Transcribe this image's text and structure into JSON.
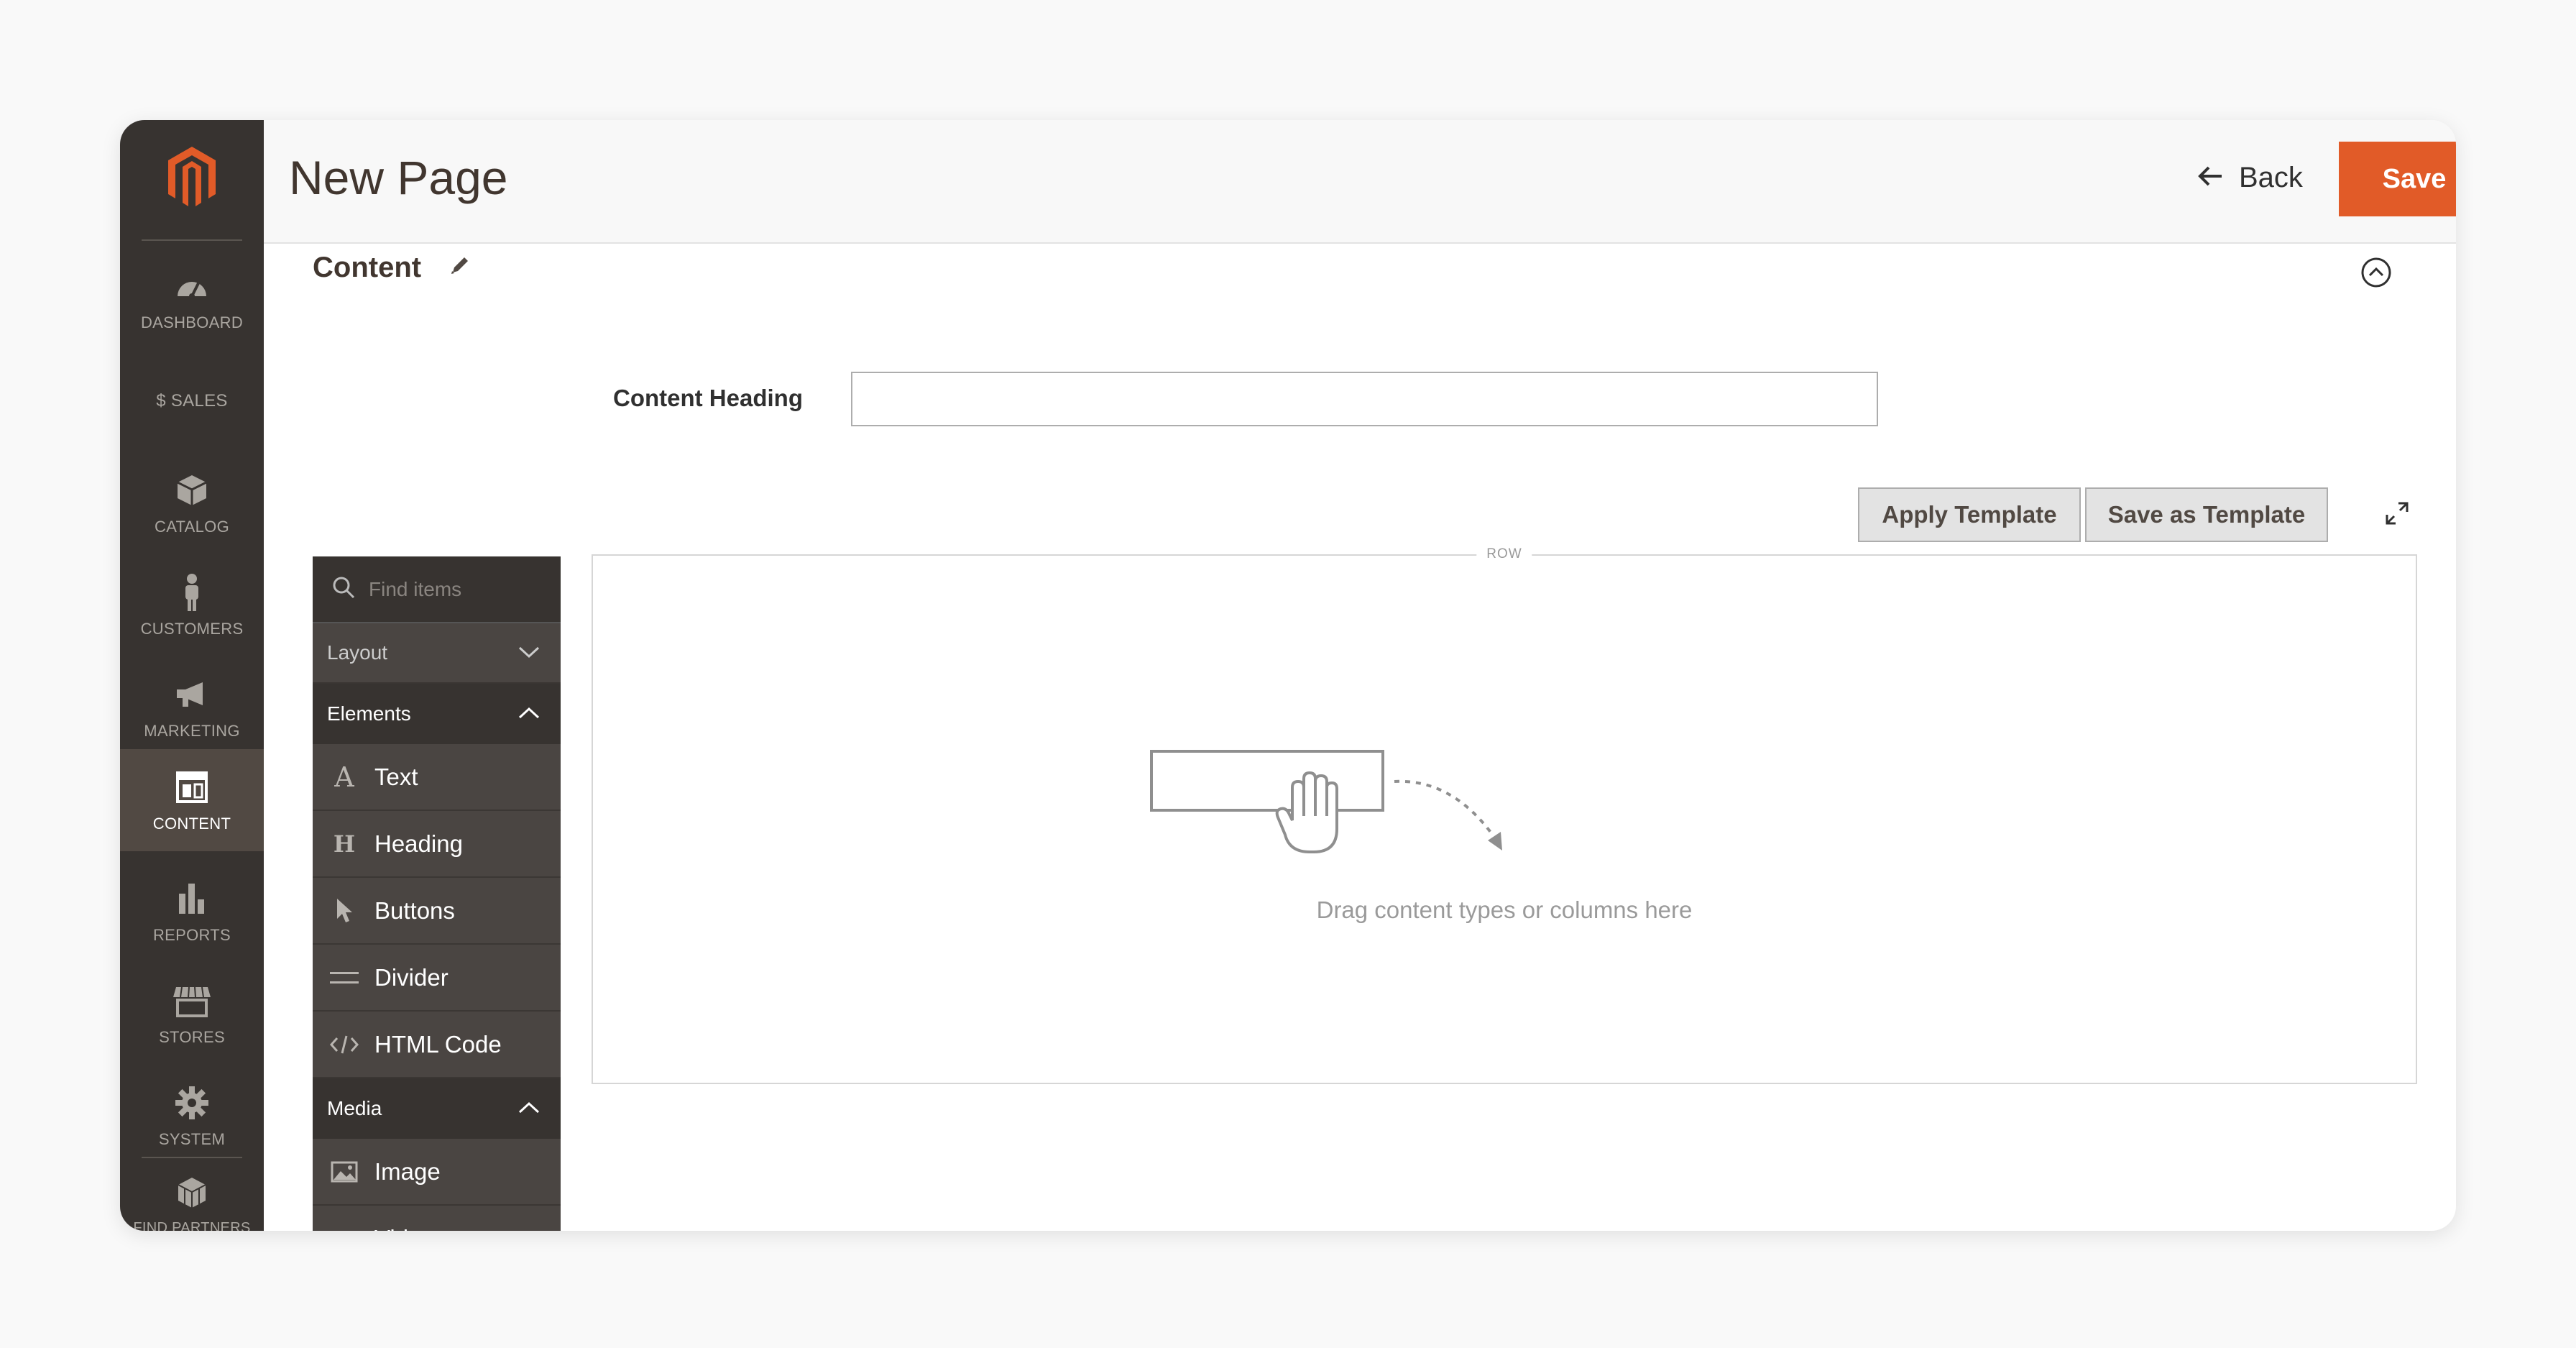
{
  "menu": {
    "items": [
      {
        "label": "Dashboard",
        "icon": "speedometer-icon"
      },
      {
        "label": "$ Sales",
        "icon": "dollar-icon"
      },
      {
        "label": "Catalog",
        "icon": "box-icon"
      },
      {
        "label": "Customers",
        "icon": "person-icon"
      },
      {
        "label": "Marketing",
        "icon": "megaphone-icon"
      },
      {
        "label": "Content",
        "icon": "layout-icon",
        "active": true
      },
      {
        "label": "Reports",
        "icon": "bar-chart-icon"
      },
      {
        "label": "Stores",
        "icon": "storefront-icon"
      },
      {
        "label": "System",
        "icon": "gear-icon"
      },
      {
        "label": "Find Partners",
        "icon": "cubes-icon"
      }
    ]
  },
  "header": {
    "title": "New Page",
    "back_label": "Back",
    "save_label": "Save"
  },
  "section": {
    "title": "Content"
  },
  "form": {
    "content_heading_label": "Content Heading",
    "content_heading_value": ""
  },
  "toolbar": {
    "apply_template": "Apply Template",
    "save_as_template": "Save as Template"
  },
  "panel": {
    "search_placeholder": "Find items",
    "layout_group": "Layout",
    "elements_group": "Elements",
    "elements": [
      {
        "label": "Text",
        "icon": "text-icon"
      },
      {
        "label": "Heading",
        "icon": "heading-icon"
      },
      {
        "label": "Buttons",
        "icon": "cursor-icon"
      },
      {
        "label": "Divider",
        "icon": "divider-icon"
      },
      {
        "label": "HTML Code",
        "icon": "code-icon"
      }
    ],
    "media_group": "Media",
    "media": [
      {
        "label": "Image",
        "icon": "image-icon"
      },
      {
        "label": "Video",
        "icon": "video-icon"
      }
    ]
  },
  "stage": {
    "row_label": "ROW",
    "drop_hint": "Drag content types or columns here"
  },
  "colors": {
    "accent": "#e15b28",
    "menu_bg": "#373330",
    "menu_active": "#514943",
    "panel_bg": "#4a4542"
  }
}
